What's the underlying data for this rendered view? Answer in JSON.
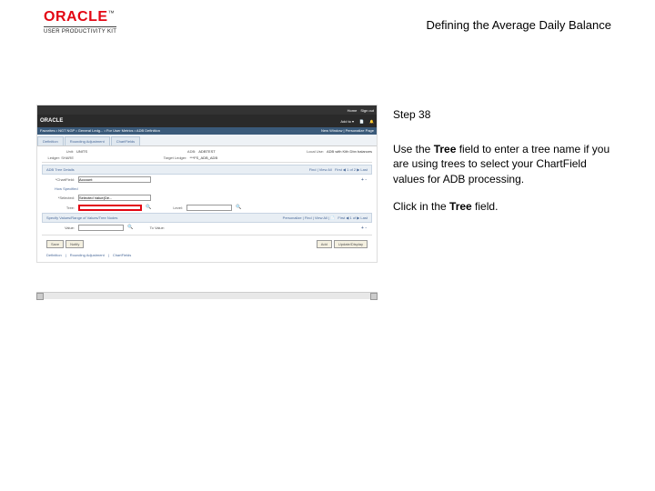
{
  "header": {
    "logo": "ORACLE",
    "tm": "™",
    "subtitle": "USER PRODUCTIVITY KIT",
    "title": "Defining the Average Daily Balance"
  },
  "panel": {
    "step": "Step 38",
    "p1a": "Use the ",
    "p1b": "Tree",
    "p1c": " field to enter a tree name if you are using trees to select your ChartField values for ADB processing.",
    "p2a": "Click in the ",
    "p2b": "Tree",
    "p2c": " field."
  },
  "app": {
    "top": {
      "home": "Home",
      "signout": "Sign out"
    },
    "bar": {
      "logo": "ORACLE",
      "addto": "Add to ▾",
      "i1": "📄",
      "i2": "🔔"
    },
    "crumb": {
      "path": "Favorites • NGT NGP • General Ledg... • For User Metrics • ADB Definition",
      "right": "New Window | Personalize Page"
    },
    "tabs": [
      "Definition",
      "Rounding Adjustment",
      "ChartFields"
    ],
    "unit_lbl": "Unit:",
    "unit_val": "UNITS",
    "adb_lbl": "ADB:",
    "adb_val": "ADBTEST",
    "tl_lbl": "Target Ledger:",
    "tl_val": "***FS_ADB_ADB",
    "loc_lbl": "Local Use:",
    "loc_val": "ADB with Kith Dbn balances",
    "sec1": "ADB Tree Details",
    "fr_link": "Find | View All",
    "fr_nav": "First ◀ 1 of 2 ▶ Last",
    "cf_lbl": "*ChartField:",
    "cf_opt": "Account",
    "spec_link": "How Specified",
    "sel_lbl": "*Selected:",
    "sel_opt": "Selected Value(De...",
    "tr_lbl": "Tree:",
    "lv_lbl": "Level:",
    "sec2": "Specify Values/Range of Values/Tree Nodes",
    "per": "Personalize | Find | View All | 📄",
    "nav2": "First ◀ 1 of ▶ Last",
    "val_lbl": "Value:",
    "to_lbl": "To Value:",
    "save": "Save",
    "notify": "Notify",
    "add": "Add",
    "upd": "Update/Display",
    "links": [
      "Definition",
      "Rounding Adjustment",
      "ChartFields"
    ]
  }
}
